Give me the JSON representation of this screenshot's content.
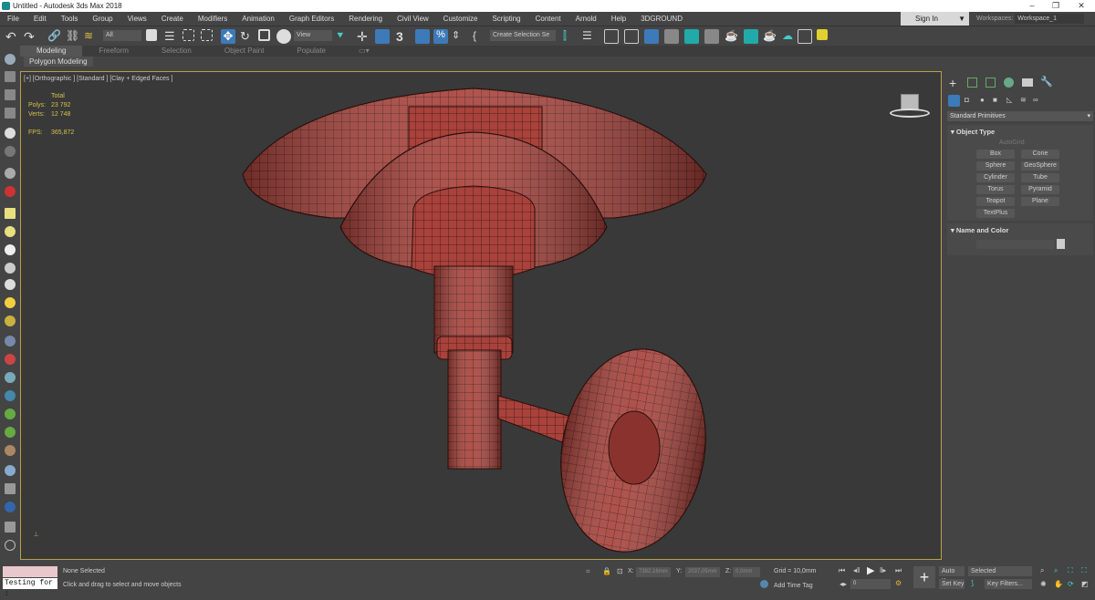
{
  "window": {
    "title": "Untitled - Autodesk 3ds Max 2018",
    "minimize": "–",
    "maximize": "❐",
    "close": "✕"
  },
  "menu": [
    "File",
    "Edit",
    "Tools",
    "Group",
    "Views",
    "Create",
    "Modifiers",
    "Animation",
    "Graph Editors",
    "Rendering",
    "Civil View",
    "Customize",
    "Scripting",
    "Content",
    "Arnold",
    "Help",
    "3DGROUND"
  ],
  "account": {
    "sign_in": "Sign In",
    "workspaces_label": "Workspaces:",
    "workspace": "Workspace_1"
  },
  "toolbar": {
    "selection_filter": "All",
    "ref_coord": "View",
    "named_selection": "Create Selection Se",
    "snap_label": "3"
  },
  "ribbon": {
    "tabs": [
      "Modeling",
      "Freeform",
      "Selection",
      "Object Paint",
      "Populate"
    ],
    "active": "Modeling",
    "panel": "Polygon Modeling"
  },
  "viewport": {
    "label": "[+] [Orthographic ] [Standard ] [Clay + Edged Faces ]",
    "stats": {
      "total": "Total",
      "polys_label": "Polys:",
      "polys": "23 792",
      "verts_label": "Verts:",
      "verts": "12 748",
      "fps_label": "FPS:",
      "fps": "365,872"
    },
    "mesh_color": "#a8423b",
    "border_color": "#b8a048"
  },
  "command_panel": {
    "category": "Standard Primitives",
    "object_type": "Object Type",
    "autogrid": "AutoGrid",
    "buttons": [
      "Box",
      "Cone",
      "Sphere",
      "GeoSphere",
      "Cylinder",
      "Tube",
      "Torus",
      "Pyramid",
      "Teapot",
      "Plane",
      "TextPlus"
    ],
    "name_and_color": "Name and Color"
  },
  "status": {
    "maxscript": "Testing for :",
    "selection": "None Selected",
    "prompt": "Click and drag to select and move objects",
    "x_label": "X:",
    "x": "7382,16mm",
    "y_label": "Y:",
    "y": "2037,05mm",
    "z_label": "Z:",
    "z": "0,0mm",
    "grid": "Grid = 10,0mm",
    "add_time_tag": "Add Time Tag",
    "frame": "0",
    "auto_key": "Auto Key",
    "set_key": "Set Key",
    "key_mode": "Selected",
    "key_filters": "Key Filters..."
  }
}
